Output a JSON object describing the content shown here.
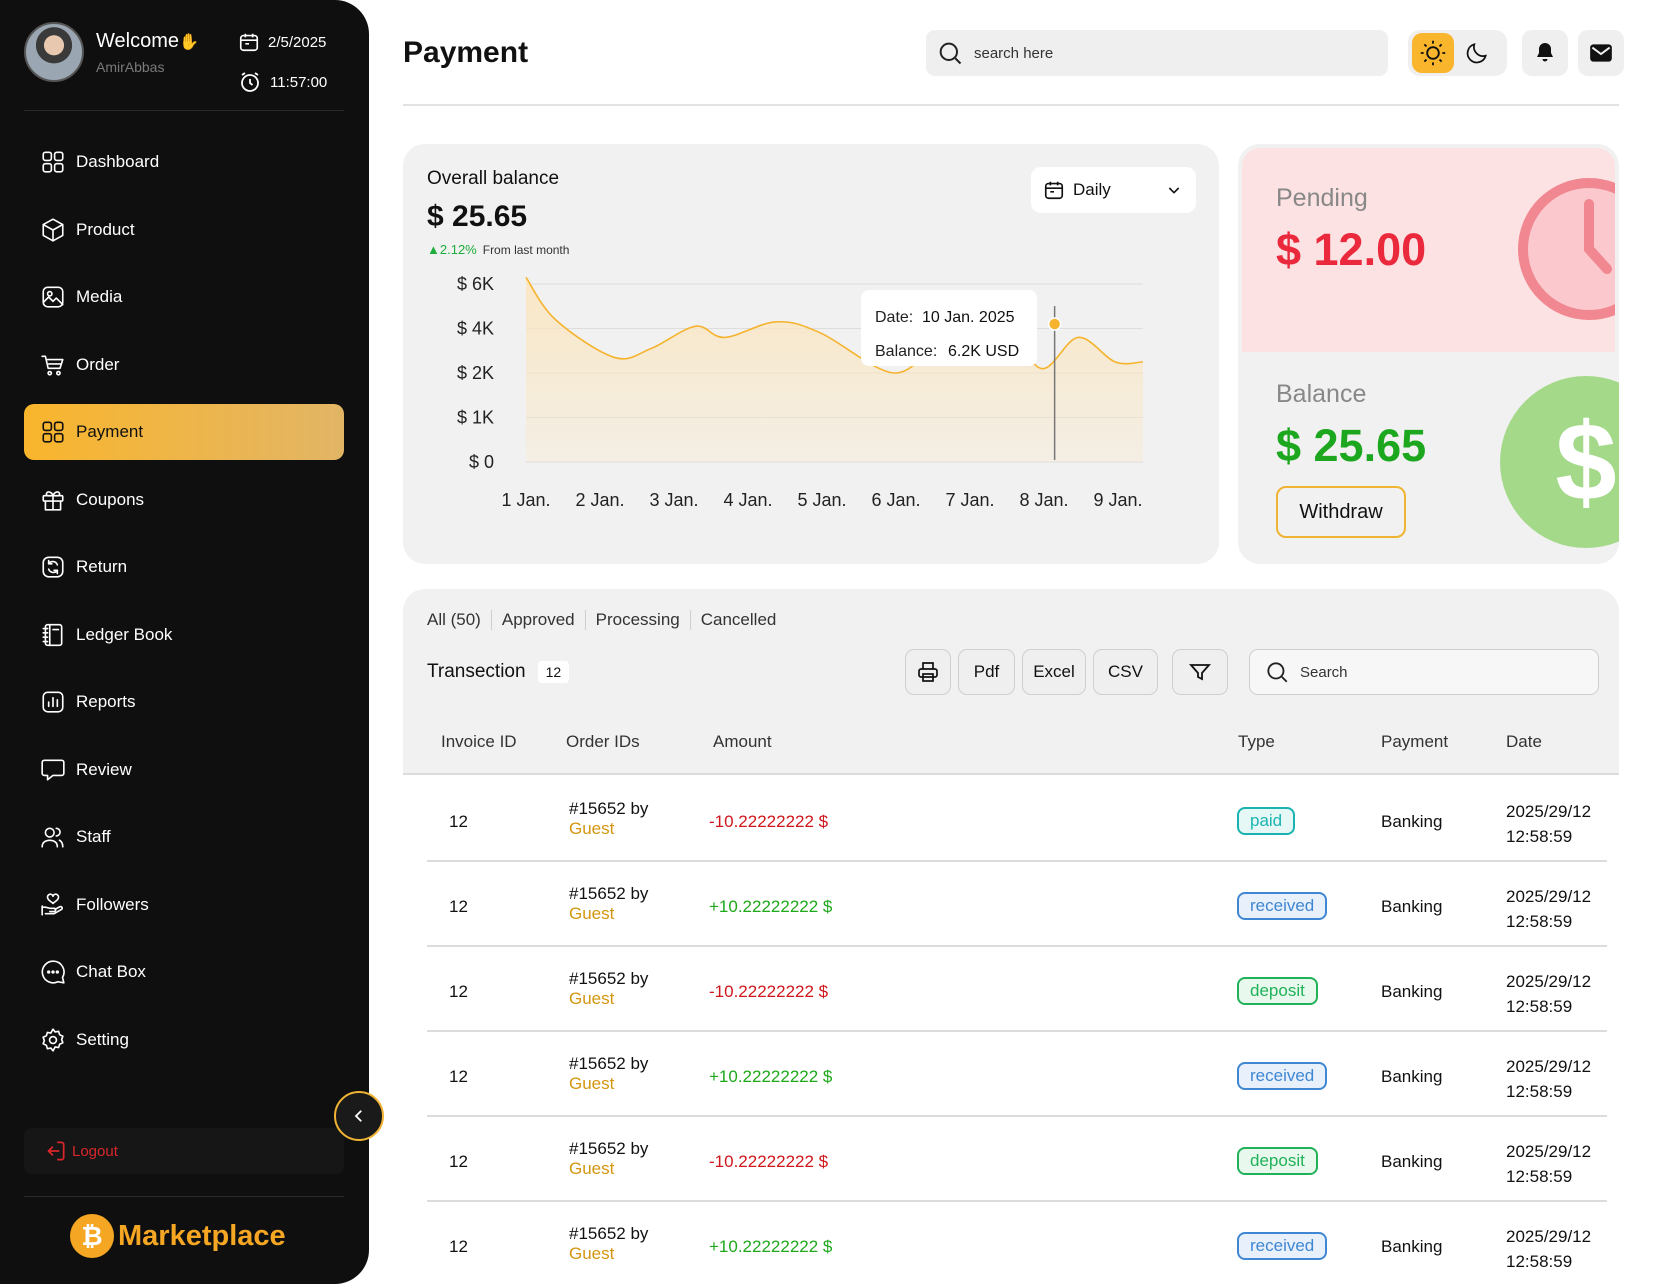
{
  "user": {
    "welcome": "Welcome",
    "wave": "✋",
    "username": "AmirAbbas"
  },
  "datetime": {
    "date": "2/5/2025",
    "time": "11:57:00"
  },
  "nav": [
    {
      "label": "Dashboard",
      "icon": "dashboard-icon"
    },
    {
      "label": "Product",
      "icon": "box-icon"
    },
    {
      "label": "Media",
      "icon": "image-icon"
    },
    {
      "label": "Order",
      "icon": "cart-icon"
    },
    {
      "label": "Payment",
      "icon": "dashboard-icon",
      "active": true
    },
    {
      "label": "Coupons",
      "icon": "gift-icon"
    },
    {
      "label": "Return",
      "icon": "refresh-icon"
    },
    {
      "label": "Ledger Book",
      "icon": "book-icon"
    },
    {
      "label": "Reports",
      "icon": "chart-icon"
    },
    {
      "label": "Review",
      "icon": "comment-icon"
    },
    {
      "label": "Staff",
      "icon": "users-icon"
    },
    {
      "label": "Followers",
      "icon": "hand-heart-icon"
    },
    {
      "label": "Chat Box",
      "icon": "chat-icon"
    },
    {
      "label": "Setting",
      "icon": "gear-icon"
    }
  ],
  "logout_label": "Logout",
  "brand": {
    "logo_glyph": "₿",
    "name": "Marketplace"
  },
  "header": {
    "title": "Payment",
    "search_placeholder": "search here"
  },
  "overall": {
    "title": "Overall balance",
    "amount": "$ 25.65",
    "change": "▲2.12%",
    "change_note": "From last month",
    "period": "Daily"
  },
  "chart_data": {
    "type": "area",
    "categories": [
      "1 Jan.",
      "2 Jan.",
      "3 Jan.",
      "4 Jan.",
      "5 Jan.",
      "6 Jan.",
      "7 Jan.",
      "8 Jan.",
      "9 Jan."
    ],
    "y_ticks": [
      "$ 0",
      "$ 1K",
      "$ 2K",
      "$ 4K",
      "$ 6K"
    ],
    "y_tick_values": [
      0,
      1,
      2,
      4,
      6
    ],
    "x": [
      1,
      1.4,
      2.2,
      2.7,
      3.3,
      3.7,
      4.4,
      5.0,
      6.0,
      6.6,
      7.0,
      7.5,
      8.0,
      8.5,
      9.0
    ],
    "y": [
      6.3,
      4.4,
      2.7,
      3.1,
      4.1,
      3.6,
      4.3,
      3.8,
      2.0,
      3.5,
      4.3,
      4.2,
      2.2,
      3.6,
      2.5
    ],
    "ylim": [
      0,
      6
    ],
    "grid": true,
    "tooltip": {
      "date_label": "Date:",
      "date_value": "10 Jan. 2025",
      "balance_label": "Balance:",
      "balance_value": "6.2K USD"
    },
    "highlight": {
      "x": 8.18,
      "y": 4.2
    },
    "colors": {
      "line": "#f5b32e",
      "fill": "#fbe6c0"
    }
  },
  "pending": {
    "label": "Pending",
    "amount": "$ 12.00"
  },
  "balance": {
    "label": "Balance",
    "amount": "$ 25.65",
    "withdraw": "Withdraw",
    "dollar_glyph": "$"
  },
  "transactions": {
    "tabs": [
      "All (50)",
      "Approved",
      "Processing",
      "Cancelled"
    ],
    "title": "Transection",
    "count": "12",
    "buttons": {
      "pdf": "Pdf",
      "excel": "Excel",
      "csv": "CSV"
    },
    "search_placeholder": "Search",
    "columns": [
      "Invoice ID",
      "Order IDs",
      "Amount",
      "Type",
      "Payment",
      "Date"
    ],
    "rows": [
      {
        "invoice": "12",
        "order": "#15652 by",
        "by": "Guest",
        "amount": "-10.22222222 $",
        "sign": "neg",
        "type": "paid",
        "payment": "Banking",
        "date": "2025/29/12",
        "time": "12:58:59"
      },
      {
        "invoice": "12",
        "order": "#15652 by",
        "by": "Guest",
        "amount": "+10.22222222 $",
        "sign": "pos",
        "type": "received",
        "payment": "Banking",
        "date": "2025/29/12",
        "time": "12:58:59"
      },
      {
        "invoice": "12",
        "order": "#15652 by",
        "by": "Guest",
        "amount": "-10.22222222 $",
        "sign": "neg",
        "type": "deposit",
        "payment": "Banking",
        "date": "2025/29/12",
        "time": "12:58:59"
      },
      {
        "invoice": "12",
        "order": "#15652 by",
        "by": "Guest",
        "amount": "+10.22222222 $",
        "sign": "pos",
        "type": "received",
        "payment": "Banking",
        "date": "2025/29/12",
        "time": "12:58:59"
      },
      {
        "invoice": "12",
        "order": "#15652 by",
        "by": "Guest",
        "amount": "-10.22222222 $",
        "sign": "neg",
        "type": "deposit",
        "payment": "Banking",
        "date": "2025/29/12",
        "time": "12:58:59"
      },
      {
        "invoice": "12",
        "order": "#15652 by",
        "by": "Guest",
        "amount": "+10.22222222 $",
        "sign": "pos",
        "type": "received",
        "payment": "Banking",
        "date": "2025/29/12",
        "time": "12:58:59"
      }
    ]
  }
}
